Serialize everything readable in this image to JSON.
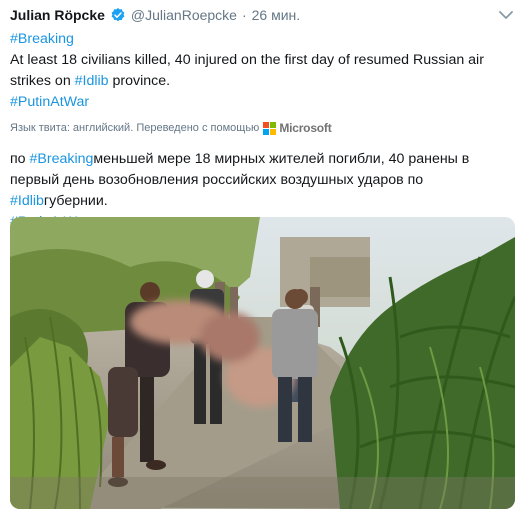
{
  "tweet": {
    "author_name": "Julian Röpcke",
    "handle": "@JulianRoepcke",
    "separator": "·",
    "time": "26 мин.",
    "original": {
      "line1": "#Breaking",
      "line2a": "At least 18 civilians killed, 40 injured on the first day of resumed Russian air strikes on ",
      "line2_tag": "#Idlib",
      "line2b": " province.",
      "line3": "#PutinAtWar"
    },
    "translation_note": "Язык твита: английский. Переведено с помощью",
    "translator_brand": "Microsoft",
    "translated": {
      "part1": "по ",
      "tag1": "#Breaking",
      "part2": "меньшей мере 18 мирных жителей погибли, 40 ранены в первый день возобновления российских воздушных ударов по ",
      "tag2": "#Idlib",
      "part3": "губернии.",
      "tag3": "#PutinAtWar"
    }
  },
  "icons": {
    "verified": "verified-badge-icon",
    "caret": "chevron-down-icon",
    "ms_logo": "microsoft-logo-icon"
  },
  "colors": {
    "hashtag": "#1b95e0",
    "verified": "#1da1f2",
    "ms_red": "#f25022",
    "ms_green": "#7fba00",
    "ms_blue": "#00a4ef",
    "ms_yellow": "#ffb900"
  }
}
